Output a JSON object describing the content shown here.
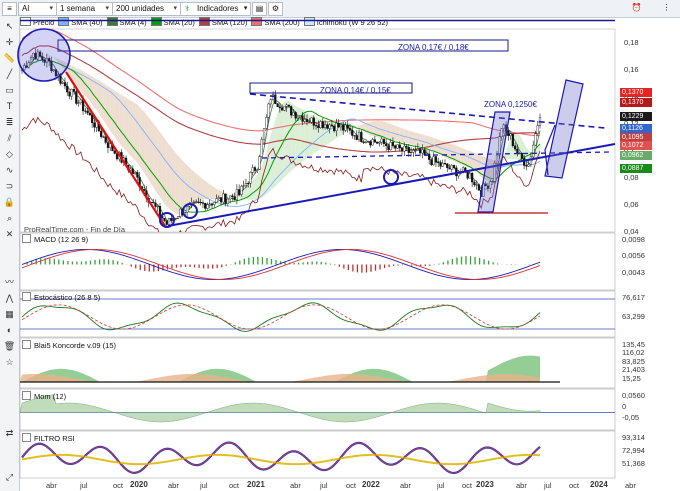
{
  "toolbar": {
    "search_value": "Al",
    "period": "1 semana",
    "units": "200 unidades",
    "indicators_label": "Indicadores"
  },
  "legend": [
    {
      "label": "Precio",
      "color": "#ffffff"
    },
    {
      "label": "SMA (40)",
      "color": "#7fb3ff"
    },
    {
      "label": "SMA (4)",
      "color": "#3a7a3a"
    },
    {
      "label": "SMA (20)",
      "color": "#00a000"
    },
    {
      "label": "SMA (120)",
      "color": "#b04040"
    },
    {
      "label": "SMA (200)",
      "color": "#f07070"
    },
    {
      "label": "Ichimoku (W 9 26 52)",
      "color": "#c9e8ff"
    }
  ],
  "price_panel": {
    "y_ticks": [
      "0,18",
      "0,16",
      "0,14",
      "0,12",
      "0,1",
      "0,08",
      "0,06",
      "0,04"
    ],
    "price_labels": [
      {
        "text": "0,1370",
        "color": "#e52424"
      },
      {
        "text": "0,1370",
        "color": "#b41a1a"
      },
      {
        "text": "0,1229",
        "color": "#1a1a1a"
      },
      {
        "text": "0,1126",
        "color": "#3366cc"
      },
      {
        "text": "0,1095",
        "color": "#c04040"
      },
      {
        "text": "0,1072",
        "color": "#e05050"
      },
      {
        "text": "0,0962",
        "color": "#6aaa6a"
      },
      {
        "text": "0,0887",
        "color": "#1a8a1a"
      }
    ],
    "annotations": {
      "zone1": "ZONA 0,17€ / 0,18€",
      "zone2": "ZONA 0,14€ / 0,15€",
      "zone3": "ZONA 0,1250€"
    },
    "footnote": "ProRealTime.com - Fin de Día"
  },
  "macd_panel": {
    "title": "MACD (12 26 9)",
    "labels": [
      "0,0098",
      "0,0056",
      "0,0043"
    ]
  },
  "stoch_panel": {
    "title": "Estocástico (26 8 5)",
    "labels": [
      "76,617",
      "63,299"
    ]
  },
  "blai_panel": {
    "title": "Blai5 Koncorde v.09 (15)",
    "labels": [
      "135,45",
      "116,02",
      "83,825",
      "21,403",
      "15,25"
    ]
  },
  "mom_panel": {
    "title": "Mom (12)",
    "labels": [
      "0,0560",
      "0",
      "-0,05"
    ]
  },
  "rsi_panel": {
    "title": "FILTRO RSI",
    "labels": [
      "93,314",
      "72,994",
      "51,368"
    ]
  },
  "x_axis": {
    "months": [
      "abr",
      "jul",
      "oct",
      "abr",
      "jul",
      "oct",
      "abr",
      "jul",
      "oct",
      "abr",
      "jul",
      "oct",
      "abr",
      "jul",
      "oct",
      "abr"
    ],
    "years": [
      "2020",
      "2021",
      "2022",
      "2023",
      "2024"
    ]
  },
  "chart_data": {
    "type": "line",
    "title": "",
    "indicators": [
      "Precio",
      "SMA (40)",
      "SMA (4)",
      "SMA (20)",
      "SMA (120)",
      "SMA (200)",
      "Ichimoku (W 9 26 52)"
    ],
    "x_labels": [
      "abr 2019",
      "jul 2019",
      "oct 2019",
      "2020",
      "abr 2020",
      "jul 2020",
      "oct 2020",
      "2021",
      "abr 2021",
      "jul 2021",
      "oct 2021",
      "2022",
      "abr 2022",
      "jul 2022",
      "oct 2022",
      "2023",
      "abr 2023",
      "jul 2023"
    ],
    "series": [
      {
        "name": "Precio",
        "values": [
          0.165,
          0.15,
          0.115,
          0.085,
          0.045,
          0.062,
          0.07,
          0.1,
          0.135,
          0.125,
          0.115,
          0.105,
          0.1,
          0.095,
          0.078,
          0.075,
          0.12,
          0.137
        ]
      }
    ],
    "ylim": [
      0.04,
      0.19
    ]
  }
}
